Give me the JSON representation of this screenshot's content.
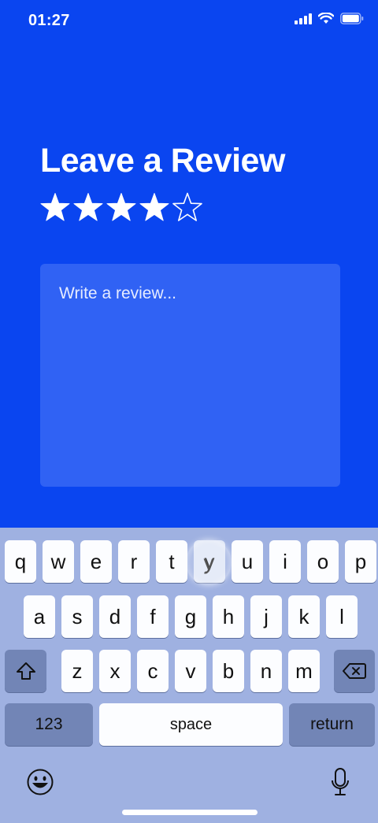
{
  "status_bar": {
    "time": "01:27"
  },
  "screen": {
    "title": "Leave a Review",
    "rating": 4,
    "max_rating": 5,
    "review_placeholder": "Write a review..."
  },
  "keyboard": {
    "row1": [
      "q",
      "w",
      "e",
      "r",
      "t",
      "y",
      "u",
      "i",
      "o",
      "p"
    ],
    "row2": [
      "a",
      "s",
      "d",
      "f",
      "g",
      "h",
      "j",
      "k",
      "l"
    ],
    "row3": [
      "z",
      "x",
      "c",
      "v",
      "b",
      "n",
      "m"
    ],
    "pressed_key": "y",
    "numbers_label": "123",
    "space_label": "space",
    "return_label": "return",
    "shift_icon": "shift-icon",
    "delete_icon": "delete-icon",
    "emoji_icon": "emoji-icon",
    "mic_icon": "microphone-icon"
  },
  "colors": {
    "background": "#0a45f0",
    "review_box": "#3062f4",
    "keyboard": "#9fb1e1",
    "function_key": "#7285b6"
  }
}
